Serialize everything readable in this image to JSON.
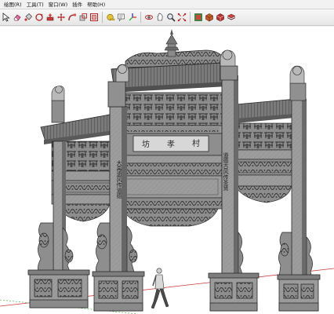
{
  "menubar": {
    "items": [
      "绘图(R)",
      "工具(T)",
      "窗口(W)",
      "插件",
      "帮助(H)"
    ]
  },
  "toolbar": {
    "icons": [
      "select-icon",
      "eraser-icon",
      "paint-bucket-icon",
      "rotate-icon",
      "push-pull-icon",
      "move-icon",
      "follow-me-icon",
      "scale-icon",
      "offset-icon",
      "tape-measure-icon",
      "text-icon",
      "axes-icon",
      "orbit-icon",
      "pan-icon",
      "zoom-icon",
      "zoom-extents-icon",
      "materials-icon",
      "components-icon",
      "styles-icon",
      "layers-icon"
    ]
  },
  "scene": {
    "plaque_chars": [
      "坊",
      "孝",
      "村"
    ],
    "left_couplet": "大禹遗风传道德",
    "right_couplet": "道德古风传圣贤",
    "colors": {
      "stone": "#9a9a9a",
      "stone_dark": "#5e5e5e",
      "stone_light": "#c4c4c4",
      "roof": "#6e6e6e",
      "line": "#2e2e2e",
      "axis_red": "#d23a3a",
      "axis_green": "#3aa33a",
      "axis_blue": "#3a5fd2"
    }
  }
}
